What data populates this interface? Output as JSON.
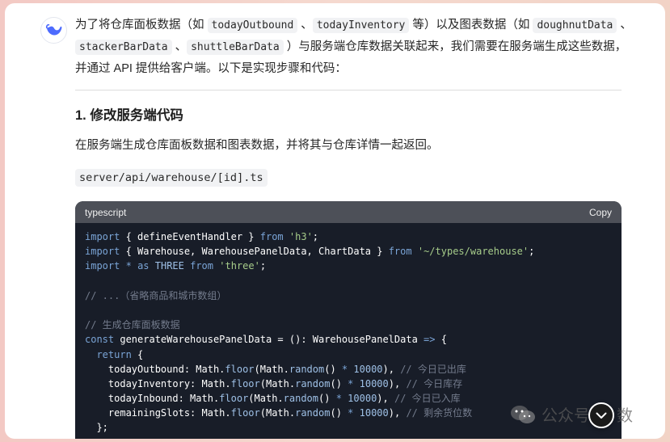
{
  "message": {
    "p1": [
      {
        "t": "text",
        "v": "为了将仓库面板数据（如 "
      },
      {
        "t": "code",
        "v": "todayOutbound"
      },
      {
        "t": "text",
        "v": " 、"
      },
      {
        "t": "code",
        "v": "todayInventory"
      },
      {
        "t": "text",
        "v": " 等）以及图表数据（如 "
      },
      {
        "t": "code",
        "v": "doughnutData"
      },
      {
        "t": "text",
        "v": " 、"
      },
      {
        "t": "code",
        "v": "stackerBarData"
      },
      {
        "t": "text",
        "v": " 、"
      },
      {
        "t": "code",
        "v": "shuttleBarData"
      },
      {
        "t": "text",
        "v": " ）与服务端仓库数据关联起来，我们需要在服务端生成这些数据，并通过 API 提供给客户端。以下是实现步骤和代码："
      }
    ],
    "heading": "1. 修改服务端代码",
    "p2": "在服务端生成仓库面板数据和图表数据，并将其与仓库详情一起返回。",
    "file_path": "server/api/warehouse/[id].ts"
  },
  "code_block": {
    "language": "typescript",
    "copy_label": "Copy",
    "lines": [
      [
        {
          "c": "k",
          "v": "import"
        },
        {
          "c": "t",
          "v": " { defineEventHandler } "
        },
        {
          "c": "k",
          "v": "from"
        },
        {
          "c": "t",
          "v": " "
        },
        {
          "c": "s",
          "v": "'h3'"
        },
        {
          "c": "t",
          "v": ";"
        }
      ],
      [
        {
          "c": "k",
          "v": "import"
        },
        {
          "c": "t",
          "v": " { Warehouse, WarehousePanelData, ChartData } "
        },
        {
          "c": "k",
          "v": "from"
        },
        {
          "c": "t",
          "v": " "
        },
        {
          "c": "s",
          "v": "'~/types/warehouse'"
        },
        {
          "c": "t",
          "v": ";"
        }
      ],
      [
        {
          "c": "k",
          "v": "import"
        },
        {
          "c": "t",
          "v": " "
        },
        {
          "c": "k",
          "v": "*"
        },
        {
          "c": "t",
          "v": " "
        },
        {
          "c": "k",
          "v": "as"
        },
        {
          "c": "t",
          "v": " "
        },
        {
          "c": "v",
          "v": "THREE"
        },
        {
          "c": "t",
          "v": " "
        },
        {
          "c": "k",
          "v": "from"
        },
        {
          "c": "t",
          "v": " "
        },
        {
          "c": "s",
          "v": "'three'"
        },
        {
          "c": "t",
          "v": ";"
        }
      ],
      [],
      [
        {
          "c": "c",
          "v": "// ...（省略商品和城市数组）"
        }
      ],
      [],
      [
        {
          "c": "c",
          "v": "// 生成仓库面板数据"
        }
      ],
      [
        {
          "c": "k",
          "v": "const"
        },
        {
          "c": "t",
          "v": " generateWarehousePanelData = (): WarehousePanelData "
        },
        {
          "c": "k",
          "v": "=>"
        },
        {
          "c": "t",
          "v": " {"
        }
      ],
      [
        {
          "c": "t",
          "v": "  "
        },
        {
          "c": "k",
          "v": "return"
        },
        {
          "c": "t",
          "v": " {"
        }
      ],
      [
        {
          "c": "t",
          "v": "    todayOutbound: Math."
        },
        {
          "c": "v",
          "v": "floor"
        },
        {
          "c": "t",
          "v": "(Math."
        },
        {
          "c": "v",
          "v": "random"
        },
        {
          "c": "t",
          "v": "() "
        },
        {
          "c": "k",
          "v": "*"
        },
        {
          "c": "t",
          "v": " "
        },
        {
          "c": "v",
          "v": "10000"
        },
        {
          "c": "t",
          "v": "), "
        },
        {
          "c": "c",
          "v": "// 今日已出库"
        }
      ],
      [
        {
          "c": "t",
          "v": "    todayInventory: Math."
        },
        {
          "c": "v",
          "v": "floor"
        },
        {
          "c": "t",
          "v": "(Math."
        },
        {
          "c": "v",
          "v": "random"
        },
        {
          "c": "t",
          "v": "() "
        },
        {
          "c": "k",
          "v": "*"
        },
        {
          "c": "t",
          "v": " "
        },
        {
          "c": "v",
          "v": "10000"
        },
        {
          "c": "t",
          "v": "), "
        },
        {
          "c": "c",
          "v": "// 今日库存"
        }
      ],
      [
        {
          "c": "t",
          "v": "    todayInbound: Math."
        },
        {
          "c": "v",
          "v": "floor"
        },
        {
          "c": "t",
          "v": "(Math."
        },
        {
          "c": "v",
          "v": "random"
        },
        {
          "c": "t",
          "v": "() "
        },
        {
          "c": "k",
          "v": "*"
        },
        {
          "c": "t",
          "v": " "
        },
        {
          "c": "v",
          "v": "10000"
        },
        {
          "c": "t",
          "v": "), "
        },
        {
          "c": "c",
          "v": "// 今日已入库"
        }
      ],
      [
        {
          "c": "t",
          "v": "    remainingSlots: Math."
        },
        {
          "c": "v",
          "v": "floor"
        },
        {
          "c": "t",
          "v": "(Math."
        },
        {
          "c": "v",
          "v": "random"
        },
        {
          "c": "t",
          "v": "() "
        },
        {
          "c": "k",
          "v": "*"
        },
        {
          "c": "t",
          "v": " "
        },
        {
          "c": "v",
          "v": "10000"
        },
        {
          "c": "t",
          "v": "), "
        },
        {
          "c": "c",
          "v": "// 剩余货位数"
        }
      ],
      [
        {
          "c": "t",
          "v": "  };"
        }
      ]
    ]
  },
  "watermark": {
    "text": "公众号",
    "tail": "数"
  },
  "icons": {
    "avatar": "deepseek-whale-icon",
    "scroll": "chevron-down-icon",
    "watermark": "wechat-icon"
  },
  "colors": {
    "accent": "#4d6bfe",
    "code_bg": "#181d28",
    "code_header": "#4d5058"
  }
}
